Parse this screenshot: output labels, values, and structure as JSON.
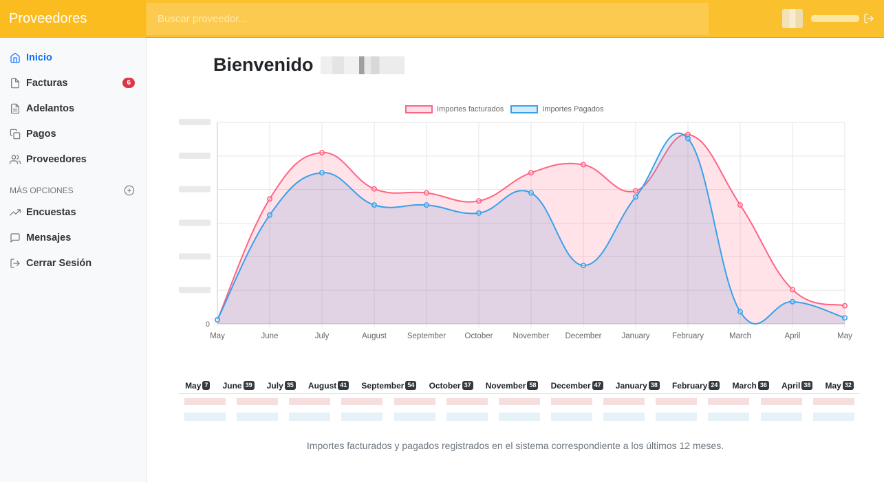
{
  "app": {
    "title": "Proveedores"
  },
  "search": {
    "placeholder": "Buscar proveedor..."
  },
  "sidebar": {
    "items": [
      {
        "label": "Inicio",
        "icon": "home-icon",
        "active": true
      },
      {
        "label": "Facturas",
        "icon": "file-icon",
        "badge": "6"
      },
      {
        "label": "Adelantos",
        "icon": "file-text-icon"
      },
      {
        "label": "Pagos",
        "icon": "copy-icon"
      },
      {
        "label": "Proveedores",
        "icon": "users-icon"
      }
    ],
    "section_title": "Más opciones",
    "more": [
      {
        "label": "Encuestas",
        "icon": "trending-up-icon"
      },
      {
        "label": "Mensajes",
        "icon": "message-icon"
      },
      {
        "label": "Cerrar Sesión",
        "icon": "logout-icon"
      }
    ]
  },
  "main": {
    "welcome": "Bienvenido",
    "caption": "Importes facturados y pagados registrados en el sistema correspondiente a los últimos 12 meses."
  },
  "colors": {
    "brand": "#fbc02d",
    "facturados": "#ff6384",
    "pagados": "#36a2eb",
    "active": "#0d6efd"
  },
  "chart_data": {
    "type": "line",
    "categories": [
      "May",
      "June",
      "July",
      "August",
      "September",
      "October",
      "November",
      "December",
      "January",
      "February",
      "March",
      "April",
      "May"
    ],
    "series": [
      {
        "name": "Importes facturados",
        "values": [
          0.02,
          0.62,
          0.85,
          0.67,
          0.65,
          0.61,
          0.75,
          0.79,
          0.66,
          0.94,
          0.59,
          0.17,
          0.09
        ]
      },
      {
        "name": "Importes Pagados",
        "values": [
          0.02,
          0.54,
          0.75,
          0.59,
          0.59,
          0.55,
          0.65,
          0.29,
          0.63,
          0.92,
          0.06,
          0.11,
          0.03
        ]
      }
    ],
    "y_tick_labels": [
      "0"
    ],
    "ylim": [
      0,
      1
    ],
    "grid": true,
    "legend": "top",
    "fill": true
  },
  "summary": {
    "months": [
      {
        "label": "May",
        "count": "7"
      },
      {
        "label": "June",
        "count": "39"
      },
      {
        "label": "July",
        "count": "35"
      },
      {
        "label": "August",
        "count": "41"
      },
      {
        "label": "September",
        "count": "54"
      },
      {
        "label": "October",
        "count": "37"
      },
      {
        "label": "November",
        "count": "58"
      },
      {
        "label": "December",
        "count": "47"
      },
      {
        "label": "January",
        "count": "38"
      },
      {
        "label": "February",
        "count": "24"
      },
      {
        "label": "March",
        "count": "36"
      },
      {
        "label": "April",
        "count": "38"
      },
      {
        "label": "May",
        "count": "32"
      }
    ]
  }
}
